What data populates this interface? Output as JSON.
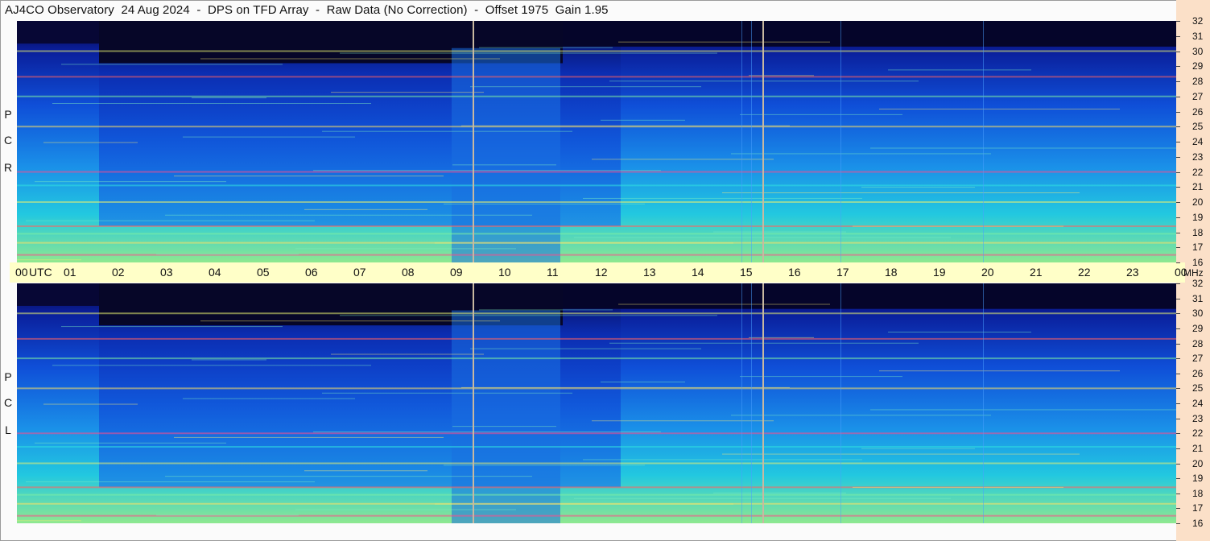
{
  "header": {
    "title": "AJ4CO Observatory  24 Aug 2024  -  DPS on TFD Array  -  Raw Data (No Correction)  -  Offset 1975  Gain 1.95"
  },
  "panels": [
    {
      "id": "rcp",
      "letters": [
        "R",
        "C",
        "P"
      ]
    },
    {
      "id": "lcp",
      "letters": [
        "L",
        "C",
        "P"
      ]
    }
  ],
  "time_axis": {
    "labels": [
      "00",
      "01",
      "02",
      "03",
      "04",
      "05",
      "06",
      "07",
      "08",
      "09",
      "10",
      "11",
      "12",
      "13",
      "14",
      "15",
      "16",
      "17",
      "18",
      "19",
      "20",
      "21",
      "22",
      "23",
      "00"
    ],
    "unit": "UTC",
    "freq_unit": "MHz"
  },
  "chart_data": {
    "type": "heatmap",
    "description_of_axes": {
      "x": "UTC hour",
      "y": "MHz"
    },
    "x_range": [
      0,
      24
    ],
    "y_range": [
      16,
      32
    ],
    "y_ticks": [
      16,
      17,
      18,
      19,
      20,
      21,
      22,
      23,
      24,
      25,
      26,
      27,
      28,
      29,
      30,
      31,
      32
    ],
    "panels": [
      "RCP",
      "LCP"
    ],
    "colormap": [
      "#07072a",
      "#0a1a8a",
      "#0d3ad0",
      "#1a7fe8",
      "#20c8e8",
      "#7fe8a0",
      "#e8f070",
      "#ff7a7a",
      "#ff3aa0"
    ],
    "vertical_markers_utc": [
      9.45,
      15.45
    ],
    "high_noise_bands_mhz": [
      16.5,
      17.3,
      17.9,
      18.4,
      20.0,
      21.1,
      22.0,
      25.0,
      27.0,
      28.3,
      30.0
    ],
    "anomaly_window_utc": [
      9.0,
      11.25
    ]
  },
  "colors": {
    "background": "#07072a",
    "axis_strip": "#ffffc8",
    "right_strip": "#fbe0c8",
    "marker_line": "#c8b8a0"
  }
}
